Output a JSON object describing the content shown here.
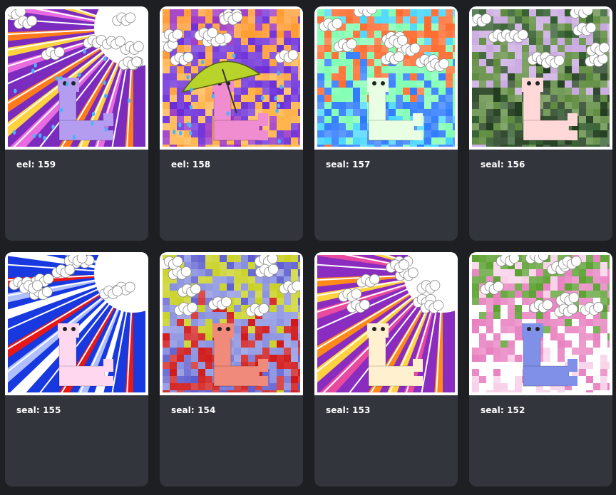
{
  "gallery": {
    "items": [
      {
        "label": "eel: 159",
        "palette": [
          "#ff7a1a",
          "#7b2cbf",
          "#e86be0",
          "#ffd23f"
        ],
        "style": "rays",
        "weather": "rain",
        "creature_color": "#b49cf0",
        "creature": "eel"
      },
      {
        "label": "eel: 158",
        "palette": [
          "#9b2fc0",
          "#ff9a2e",
          "#6a2bd8",
          "#ffb347"
        ],
        "style": "pixel",
        "weather": "rain-umbrella",
        "creature_color": "#f08cd0",
        "creature": "eel"
      },
      {
        "label": "seal: 157",
        "palette": [
          "#44d6ff",
          "#ff6b2e",
          "#7dffb0",
          "#2f7bff"
        ],
        "style": "pixel",
        "weather": "clouds",
        "creature_color": "#e8ffe4",
        "creature": "seal"
      },
      {
        "label": "seal: 156",
        "palette": [
          "#2e5a2a",
          "#c9a8e0",
          "#5c8a3c",
          "#1f3b1c"
        ],
        "style": "pixel",
        "weather": "clouds",
        "creature_color": "#ffd8d8",
        "creature": "seal"
      },
      {
        "label": "seal: 155",
        "palette": [
          "#e81818",
          "#1838e0",
          "#ffffff",
          "#b0c0ff"
        ],
        "style": "rays",
        "weather": "clouds",
        "creature_color": "#ffd8f0",
        "creature": "seal"
      },
      {
        "label": "seal: 154",
        "palette": [
          "#5a5ad0",
          "#c8d020",
          "#8890e0",
          "#d01818"
        ],
        "style": "pixel",
        "weather": "clouds",
        "creature_color": "#f08a7a",
        "creature": "seal"
      },
      {
        "label": "seal: 153",
        "palette": [
          "#ff8a1a",
          "#8a2cbf",
          "#e84aa0",
          "#ffd23f"
        ],
        "style": "rays",
        "weather": "clouds",
        "creature_color": "#fff0d0",
        "creature": "seal"
      },
      {
        "label": "seal: 152",
        "palette": [
          "#f8d0e8",
          "#5aa030",
          "#e880c0",
          "#ffffff"
        ],
        "style": "pixel",
        "weather": "clouds",
        "creature_color": "#8090e8",
        "creature": "seal"
      }
    ]
  }
}
